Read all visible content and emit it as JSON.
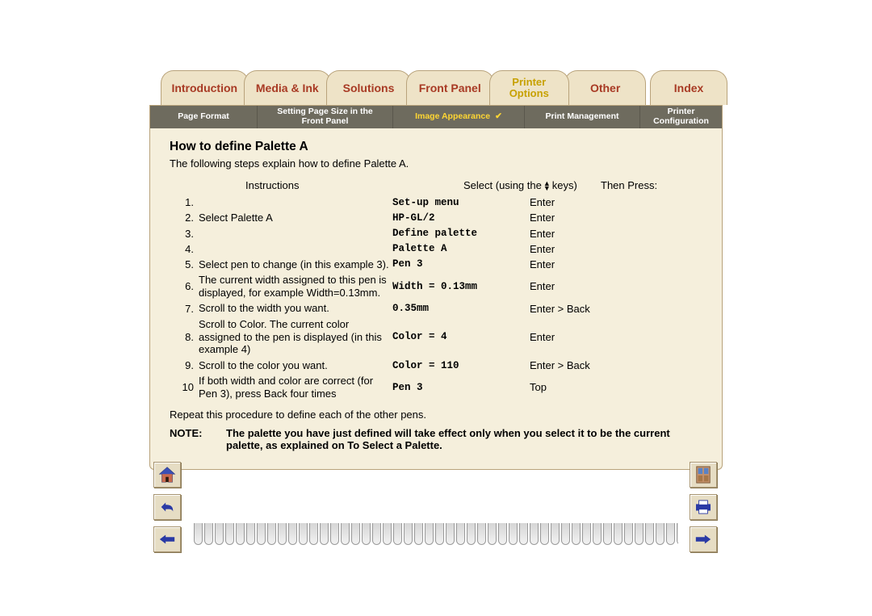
{
  "tabs": {
    "introduction": "Introduction",
    "media_ink": "Media & Ink",
    "solutions": "Solutions",
    "front_panel": "Front Panel",
    "printer_line1": "Printer",
    "printer_line2": "Options",
    "other": "Other",
    "index": "Index"
  },
  "subtabs": {
    "page_format": "Page Format",
    "setting_page_size": "Setting Page Size in the\nFront Panel",
    "image_appearance": "Image Appearance",
    "print_management": "Print Management",
    "printer_configuration": "Printer Configuration",
    "check": "✔"
  },
  "content": {
    "heading": "How to define Palette A",
    "subtitle": "The following steps explain how to define Palette A.",
    "header_instructions": "Instructions",
    "header_select_prefix": "Select (using the",
    "header_select_suffix": "keys)",
    "header_press": "Then Press:",
    "rows": [
      {
        "num": "1.",
        "instr": "",
        "select": "Set-up menu",
        "press": "Enter"
      },
      {
        "num": "2.",
        "instr": "Select Palette A",
        "select": "HP-GL/2",
        "press": "Enter"
      },
      {
        "num": "3.",
        "instr": "",
        "select": "Define palette",
        "press": "Enter"
      },
      {
        "num": "4.",
        "instr": "",
        "select": "Palette A",
        "press": "Enter"
      },
      {
        "num": "5.",
        "instr": "Select pen to change (in this example 3).",
        "select": "Pen 3",
        "press": "Enter"
      },
      {
        "num": "6.",
        "instr": "The current width assigned to this pen is displayed, for example Width=0.13mm.",
        "select": "Width = 0.13mm",
        "press": "Enter"
      },
      {
        "num": "7.",
        "instr": "Scroll to the width you want.",
        "select": "0.35mm",
        "press": "Enter > Back"
      },
      {
        "num": "8.",
        "instr": "Scroll to Color. The current color assigned to the pen is displayed (in this example 4)",
        "select": "Color = 4",
        "press": "Enter"
      },
      {
        "num": "9.",
        "instr": "Scroll to the color you want.",
        "select": "Color = 110",
        "press": "Enter > Back"
      },
      {
        "num": "10",
        "instr": "If both width and color are correct (for Pen 3), press Back four times",
        "select": "Pen 3",
        "press": "Top"
      }
    ],
    "repeat": "Repeat this procedure to define each of the other pens.",
    "note_label": "NOTE:",
    "note_text": "The palette you have just defined will take effect only when you select it to be the current palette, as explained on To Select a Palette."
  },
  "nav": {
    "home": "home-icon",
    "back": "back-icon",
    "prev": "prev-icon",
    "exit": "exit-icon",
    "print": "print-icon",
    "next": "next-icon"
  }
}
